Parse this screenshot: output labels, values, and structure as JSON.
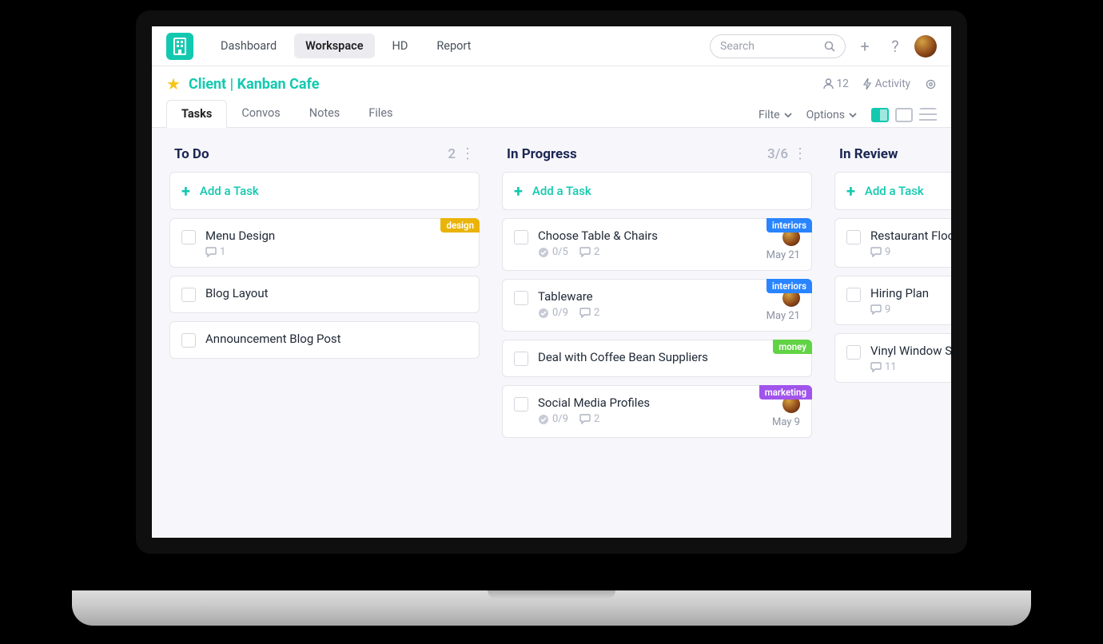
{
  "nav": {
    "items": [
      "Dashboard",
      "Workspace",
      "HD",
      "Report"
    ],
    "active_index": 1
  },
  "search": {
    "placeholder": "Search"
  },
  "header_icons": {
    "plus": "+",
    "help": "?"
  },
  "client": {
    "title": "Client | Kanban Cafe",
    "people_count": "12",
    "activity_label": "Activity"
  },
  "tabs": {
    "items": [
      "Tasks",
      "Convos",
      "Notes",
      "Files"
    ],
    "active_index": 0,
    "filter_label": "Filte",
    "options_label": "Options"
  },
  "add_task_label": "Add a Task",
  "columns": [
    {
      "title": "To Do",
      "count": "2",
      "cards": [
        {
          "title": "Menu Design",
          "tag": "design",
          "subtasks": "",
          "comments": "1",
          "due": "",
          "avatar": false
        },
        {
          "title": "Blog Layout",
          "tag": "",
          "subtasks": "",
          "comments": "",
          "due": "",
          "avatar": false
        },
        {
          "title": "Announcement Blog Post",
          "tag": "",
          "subtasks": "",
          "comments": "",
          "due": "",
          "avatar": false
        }
      ]
    },
    {
      "title": "In Progress",
      "count": "3/6",
      "cards": [
        {
          "title": "Choose Table & Chairs",
          "tag": "interiors",
          "subtasks": "0/5",
          "comments": "2",
          "due": "May 21",
          "avatar": true
        },
        {
          "title": "Tableware",
          "tag": "interiors",
          "subtasks": "0/9",
          "comments": "2",
          "due": "May 21",
          "avatar": true
        },
        {
          "title": "Deal with Coffee Bean Suppliers",
          "tag": "money",
          "subtasks": "",
          "comments": "",
          "due": "",
          "avatar": false
        },
        {
          "title": "Social Media Profiles",
          "tag": "marketing",
          "subtasks": "0/9",
          "comments": "2",
          "due": "May 9",
          "avatar": true
        }
      ]
    },
    {
      "title": "In Review",
      "count": "",
      "cards": [
        {
          "title": "Restaurant Floor Plan",
          "tag": "",
          "subtasks": "",
          "comments": "9",
          "due": "",
          "avatar": false
        },
        {
          "title": "Hiring Plan",
          "tag": "",
          "subtasks": "",
          "comments": "9",
          "due": "",
          "avatar": false
        },
        {
          "title": "Vinyl Window Stickers",
          "tag": "",
          "subtasks": "",
          "comments": "11",
          "due": "",
          "avatar": false
        }
      ]
    }
  ]
}
